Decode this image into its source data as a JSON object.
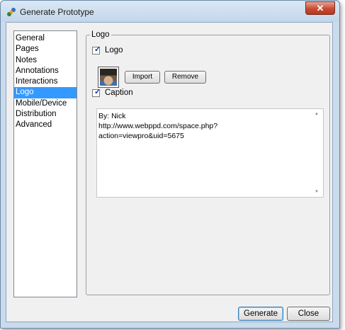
{
  "window": {
    "title": "Generate Prototype",
    "close_label": "✕"
  },
  "nav": {
    "items": [
      {
        "label": "General",
        "selected": false
      },
      {
        "label": "Pages",
        "selected": false
      },
      {
        "label": "Notes",
        "selected": false
      },
      {
        "label": "Annotations",
        "selected": false
      },
      {
        "label": "Interactions",
        "selected": false
      },
      {
        "label": "Logo",
        "selected": true
      },
      {
        "label": "Mobile/Device",
        "selected": false
      },
      {
        "label": "Distribution",
        "selected": false
      },
      {
        "label": "Advanced",
        "selected": false
      }
    ]
  },
  "logo_group": {
    "legend": "Logo",
    "logo_checkbox": {
      "label": "Logo",
      "checked": true
    },
    "import_label": "Import",
    "remove_label": "Remove",
    "caption_checkbox": {
      "label": "Caption",
      "checked": true
    },
    "caption_text": "By: Nick\nhttp://www.webppd.com/space.php?\naction=viewpro&uid=5675"
  },
  "footer": {
    "generate_label": "Generate",
    "close_label": "Close"
  },
  "colors": {
    "selection": "#3399ff",
    "title_close": "#c84a34"
  }
}
